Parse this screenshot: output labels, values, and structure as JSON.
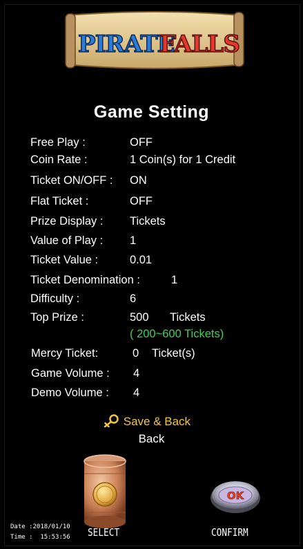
{
  "logo": {
    "text_left": "PIRATE",
    "text_right": "FALLS"
  },
  "title": "Game Setting",
  "settings": [
    {
      "label": "Free Play :",
      "value": "OFF"
    },
    {
      "label": "Coin Rate :",
      "value": "1 Coin(s) for 1 Credit"
    },
    {
      "label": "Ticket ON/OFF :",
      "value": "ON"
    },
    {
      "label": "Flat Ticket :",
      "value": "OFF"
    },
    {
      "label": "Prize Display :",
      "value": "Tickets"
    },
    {
      "label": "Value of Play :",
      "value": "1"
    },
    {
      "label": "Ticket Value :",
      "value": "0.01"
    },
    {
      "label": "Ticket Denomination :",
      "value": "1"
    },
    {
      "label": "Difficulty :",
      "value": "6"
    },
    {
      "label": "Top Prize :",
      "value": "500",
      "unit": "Tickets",
      "range": "( 200~600  Tickets)"
    },
    {
      "label": "Mercy Ticket:",
      "value": "0",
      "unit": "Ticket(s)"
    },
    {
      "label": "Game Volume :",
      "value": "4"
    },
    {
      "label": "Demo Volume :",
      "value": "4"
    }
  ],
  "menu": {
    "save_back": "Save & Back",
    "back": "Back"
  },
  "buttons": {
    "select": "SELECT",
    "confirm": "CONFIRM",
    "ok_badge": "OK"
  },
  "status": {
    "date": "Date :2018/01/10",
    "time": "Time :  15:53:56"
  },
  "colors": {
    "highlight": "#f2c640",
    "range_text": "#3fd05a",
    "background": "#000000"
  }
}
